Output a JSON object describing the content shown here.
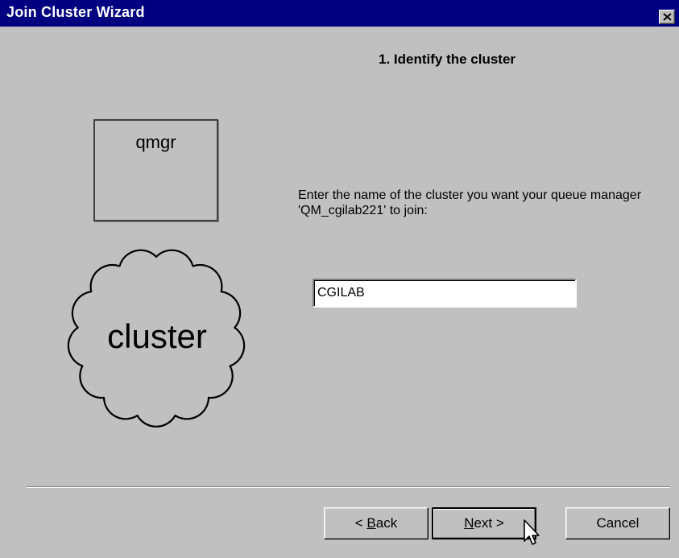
{
  "window": {
    "title": "Join Cluster Wizard"
  },
  "step": {
    "heading": "1. Identify the cluster"
  },
  "diagram": {
    "qmgr_label": "qmgr",
    "cluster_label": "cluster"
  },
  "form": {
    "instruction": "Enter the name of the cluster you want your queue manager 'QM_cgilab221' to join:",
    "cluster_name_value": "CGILAB"
  },
  "buttons": {
    "back_prefix": "< ",
    "back_accel": "B",
    "back_rest": "ack",
    "next_accel": "N",
    "next_rest": "ext >",
    "cancel": "Cancel"
  },
  "colors": {
    "titlebar": "#000080",
    "dialog_bg": "#c0c0c0"
  },
  "icons": {
    "close": "close-icon",
    "cursor": "mouse-pointer-icon"
  }
}
